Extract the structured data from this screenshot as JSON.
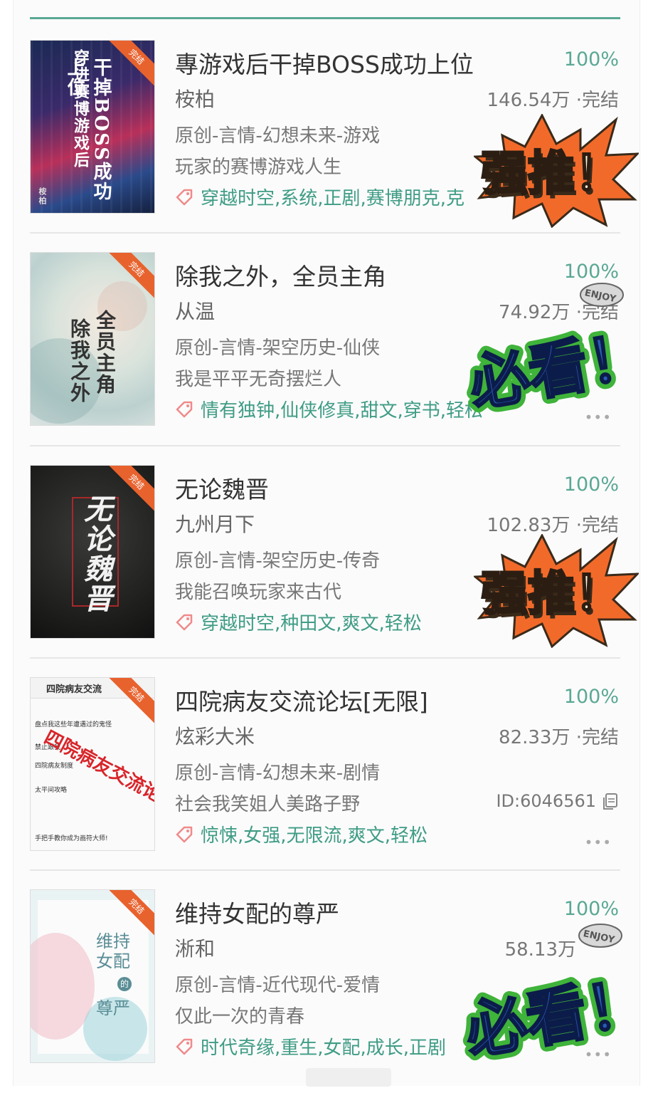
{
  "colors": {
    "accent": "#5aa894",
    "tag": "#3f9c85",
    "badge": "#e8622e",
    "sticker_orange": "#f26a2a",
    "sticker_green": "#3fb33a",
    "sticker_blue": "#2a5bb5"
  },
  "books": [
    {
      "title": "專游戏后干掉BOSS成功上位",
      "percent": "100%",
      "author": "桉柏",
      "stats": "146.54万 ·完结",
      "genre": "原创-言情-幻想未来-游戏",
      "tagline": "玩家的赛博游戏人生",
      "tags": "穿越时空,系统,正剧,赛博朋克,克",
      "badge": "完结",
      "cover_title": "干掉BOSS成功上位",
      "cover_title2": "穿进赛博游戏后",
      "cover_author": "桉柏",
      "sticker": "强推！"
    },
    {
      "title": "除我之外，全员主角",
      "percent": "100%",
      "author": "从温",
      "stats": "74.92万 ·完结",
      "genre": "原创-言情-架空历史-仙侠",
      "tagline": "我是平平无奇摆烂人",
      "tags": "情有独钟,仙侠修真,甜文,穿书,轻松",
      "badge": "完结",
      "cover_title": "全员主角",
      "cover_title2": "除我之外",
      "sticker": "必看！",
      "enjoy": "ENJOY"
    },
    {
      "title": "无论魏晋",
      "percent": "100%",
      "author": "九州月下",
      "stats": "102.83万 ·完结",
      "genre": "原创-言情-架空历史-传奇",
      "tagline": "我能召唤玩家来古代",
      "tags": "穿越时空,种田文,爽文,轻松",
      "badge": "完结",
      "cover_title": "无论魏晋",
      "sticker": "强推！"
    },
    {
      "title": "四院病友交流论坛[无限]",
      "percent": "100%",
      "author": "炫彩大米",
      "stats": "82.33万 ·完结",
      "genre": "原创-言情-幻想未来-剧情",
      "tagline": "社会我笑姐人美路子野",
      "book_id": "ID:6046561",
      "tags": "惊悚,女强,无限流,爽文,轻松",
      "badge": "完结",
      "cover_header": "四院病友交流",
      "cover_title": "四院病友交流论坛",
      "cover_lines": [
        "盘点我这些年遭遇过的鬼怪",
        "禁止跟我",
        "四院病友制度",
        "太平间攻略",
        "手把手教你成为画符大师!"
      ]
    },
    {
      "title": "维持女配的尊严",
      "percent": "100%",
      "author": "淅和",
      "stats": "58.13万",
      "genre": "原创-言情-近代现代-爱情",
      "tagline": "仅此一次的青春",
      "tags": "时代奇缘,重生,女配,成长,正剧",
      "badge": "完结",
      "cover_title": "维持女配",
      "cover_de": "的",
      "cover_title2": "尊严",
      "sticker": "必看！",
      "enjoy": "ENJOY"
    }
  ],
  "more_label": "•••"
}
